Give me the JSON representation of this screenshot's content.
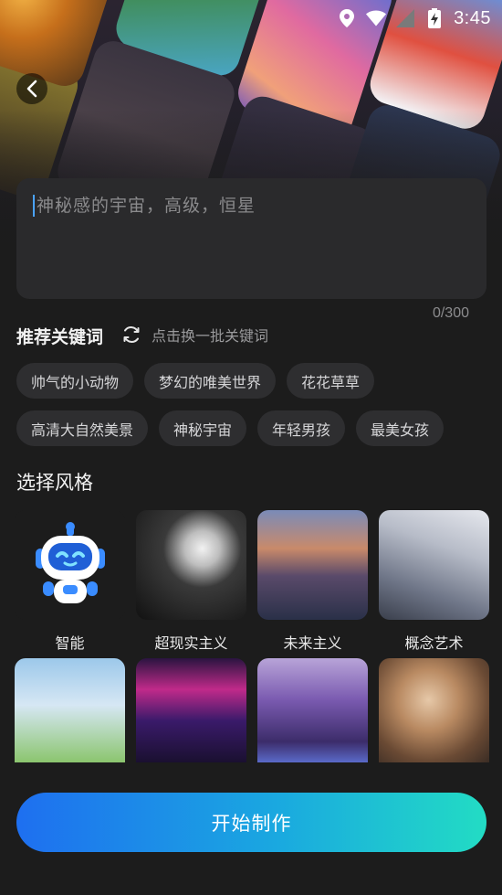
{
  "status_bar": {
    "time": "3:45"
  },
  "prompt": {
    "placeholder": "神秘感的宇宙，高级，恒星",
    "counter": "0/300"
  },
  "keywords": {
    "title": "推荐关键词",
    "refresh_label": "点击换一批关键词",
    "rows": [
      [
        "帅气的小动物",
        "梦幻的唯美世界",
        "花花草草"
      ],
      [
        "高清大自然美景",
        "神秘宇宙",
        "年轻男孩",
        "最美女孩"
      ]
    ]
  },
  "styles": {
    "title": "选择风格",
    "row1": [
      {
        "label": "智能",
        "thumb": "robot-icon"
      },
      {
        "label": "超现实主义",
        "thumb": "surreal"
      },
      {
        "label": "未来主义",
        "thumb": "future"
      },
      {
        "label": "概念艺术",
        "thumb": "concept"
      }
    ],
    "row2": [
      {
        "thumb": "anime"
      },
      {
        "thumb": "cyber"
      },
      {
        "thumb": "purple"
      },
      {
        "thumb": "paint"
      }
    ]
  },
  "start_button": {
    "label": "开始制作"
  },
  "colors": {
    "accent_start": "#1e6ff0",
    "accent_end": "#22dcc4",
    "background": "#1c1c1c",
    "chip": "#2e2e30"
  }
}
